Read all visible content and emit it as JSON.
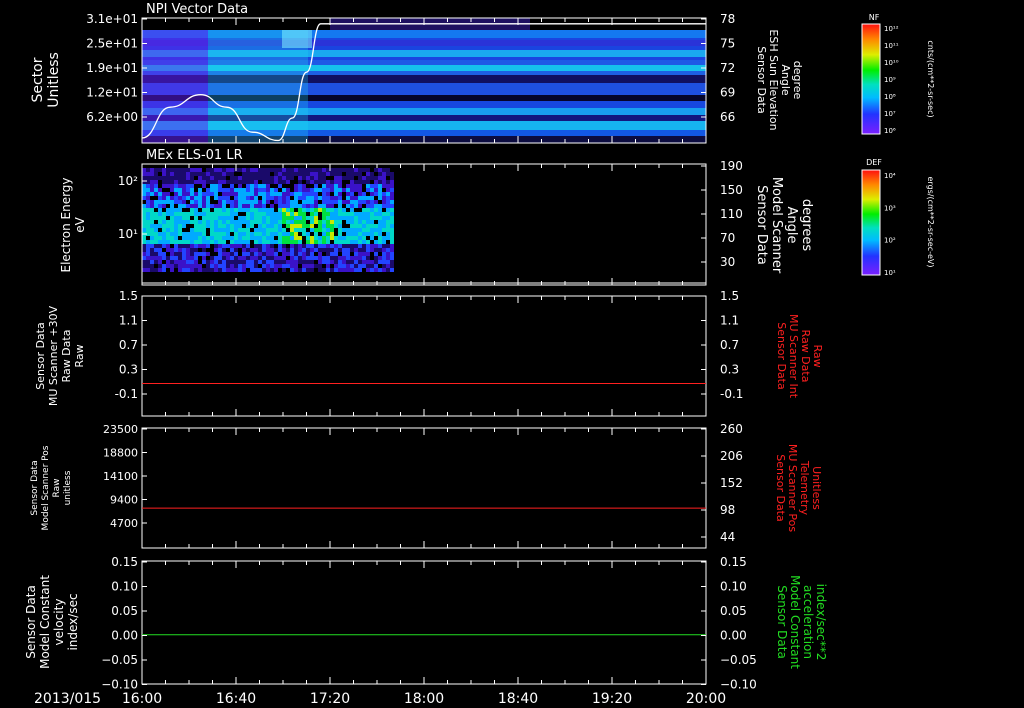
{
  "date_label": "2013/015",
  "time_axis": {
    "ticks": [
      "16:00",
      "16:40",
      "17:20",
      "18:00",
      "18:40",
      "19:20",
      "20:00"
    ]
  },
  "colors": {
    "white": "#ffffff",
    "red": "#ff2020",
    "green": "#22dd22"
  },
  "chart_data": [
    {
      "type": "heatmap",
      "title": "NPI Vector Data",
      "ylabel_left": [
        "Sector",
        "Unitless"
      ],
      "left_ticks": [
        "3.1e+01",
        "2.5e+01",
        "1.9e+01",
        "1.2e+01",
        "6.2e+00"
      ],
      "ylabel_right": [
        "Sensor Data",
        "ESH Sun Elevation",
        "Angle",
        "degree"
      ],
      "right_ticks": [
        "78",
        "75",
        "72",
        "69",
        "66"
      ],
      "right_ylim": [
        63,
        78
      ],
      "overlay_line": {
        "x": [
          "16:00",
          "16:12",
          "16:25",
          "16:36",
          "16:47",
          "16:58",
          "17:04",
          "17:10",
          "17:16",
          "20:00"
        ],
        "y": [
          63.6,
          67.3,
          68.8,
          67.3,
          64.3,
          63.3,
          66.0,
          71.5,
          77.3,
          77.3
        ]
      },
      "colorbar": {
        "label": "NF",
        "units": "cnts/(cm**2-sr-sec)",
        "ticks": [
          "10¹²",
          "10¹¹",
          "10¹⁰",
          "10⁹",
          "10⁸",
          "10⁷",
          "10⁶"
        ]
      }
    },
    {
      "type": "heatmap",
      "title": "MEx ELS-01 LR",
      "ylabel_left": [
        "Electron Energy",
        "eV"
      ],
      "left_ticks": [
        "10²",
        "10¹"
      ],
      "ylabel_right": [
        "Sensor Data",
        "Model Scanner",
        "Angle",
        "degrees"
      ],
      "right_ticks": [
        "190",
        "150",
        "110",
        "70",
        "30"
      ],
      "right_ylim": [
        5,
        190
      ],
      "data_end": "17:47",
      "overlay_line": {
        "x": [
          "16:00",
          "20:00"
        ],
        "y": [
          8,
          8
        ]
      },
      "colorbar": {
        "label": "DEF",
        "units": "ergs/(cm**2-sr-sec-eV)",
        "ticks": [
          "10⁴",
          "10³",
          "10²",
          "10¹"
        ]
      }
    },
    {
      "type": "line",
      "ylabel_left": [
        "Sensor Data",
        "MU Scanner +30V",
        "Raw Data",
        "Raw"
      ],
      "left_ticks": [
        "1.5",
        "1.1",
        "0.7",
        "0.3",
        "-0.1"
      ],
      "left_ylim": [
        -0.42,
        1.5
      ],
      "ylabel_right": [
        "Sensor Data",
        "MU Scanner Int",
        "Raw Data",
        "Raw"
      ],
      "right_ticks": [
        "1.5",
        "1.1",
        "0.7",
        "0.3",
        "-0.1"
      ],
      "series": [
        {
          "color": "#ff2020",
          "x": [
            "16:00",
            "20:00"
          ],
          "y": [
            0.1,
            0.1
          ]
        }
      ]
    },
    {
      "type": "line",
      "ylabel_left": [
        "Sensor Data",
        "Model Scanner Pos",
        "Raw",
        "unitless"
      ],
      "left_ticks": [
        "23500",
        "18800",
        "14100",
        "9400",
        "4700"
      ],
      "left_ylim": [
        0,
        23500
      ],
      "ylabel_right": [
        "Sensor Data",
        "MU Scanner Pos",
        "Telemetry",
        "Unitless"
      ],
      "right_ticks": [
        "260",
        "206",
        "152",
        "98",
        "44"
      ],
      "series": [
        {
          "color": "#ff2020",
          "x": [
            "16:00",
            "20:00"
          ],
          "y": [
            7800,
            7800
          ]
        }
      ]
    },
    {
      "type": "line",
      "ylabel_left": [
        "Sensor Data",
        "Model Constant",
        "velocity",
        "index/sec"
      ],
      "left_ticks": [
        "0.15",
        "0.10",
        "0.05",
        "0.00",
        "−0.05",
        "−0.10"
      ],
      "left_ylim": [
        -0.1,
        0.15
      ],
      "ylabel_right": [
        "Sensor Data",
        "Model Constant",
        "acceleration",
        "index/sec**2"
      ],
      "right_ticks": [
        "0.15",
        "0.10",
        "0.05",
        "0.00",
        "−0.05",
        "−0.10"
      ],
      "series": [
        {
          "color": "#22dd22",
          "x": [
            "16:00",
            "20:00"
          ],
          "y": [
            0,
            0
          ]
        }
      ]
    }
  ]
}
